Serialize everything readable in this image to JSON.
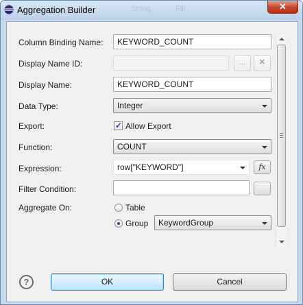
{
  "window": {
    "title": "Aggregation Builder",
    "close_label": "✕"
  },
  "background_tabs": [
    "String",
    "Fill"
  ],
  "fields": {
    "column_binding_name": {
      "label": "Column Binding Name:",
      "value": "KEYWORD_COUNT"
    },
    "display_name_id": {
      "label": "Display Name ID:",
      "value": ""
    },
    "display_name": {
      "label": "Display Name:",
      "value": "KEYWORD_COUNT"
    },
    "data_type": {
      "label": "Data Type:",
      "value": "Integer"
    },
    "export": {
      "label": "Export:",
      "checkbox_label": "Allow Export",
      "checked": true
    },
    "function": {
      "label": "Function:",
      "value": "COUNT"
    },
    "expression": {
      "label": "Expression:",
      "value": "row[\"KEYWORD\"]"
    },
    "filter_condition": {
      "label": "Filter Condition:",
      "value": ""
    },
    "aggregate_on": {
      "label": "Aggregate On:",
      "options": [
        "Table",
        "Group"
      ],
      "selected": "Group",
      "group_value": "KeywordGroup"
    }
  },
  "icons": {
    "ellipsis": "...",
    "clear": "✕",
    "function_builder": "fx",
    "help": "?"
  },
  "buttons": {
    "ok": "OK",
    "cancel": "Cancel"
  }
}
